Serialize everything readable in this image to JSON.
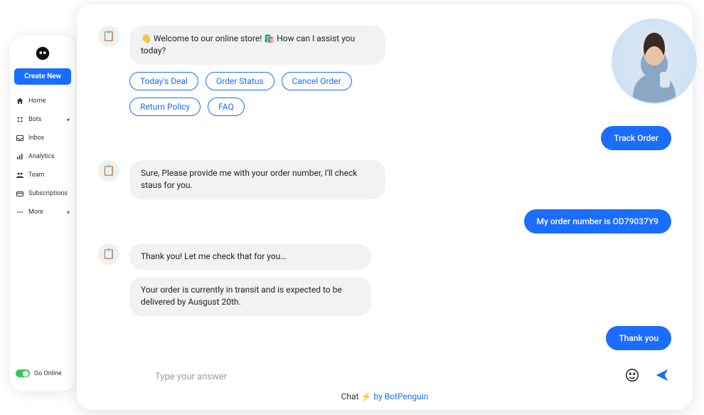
{
  "sidebar": {
    "create_label": "Create New",
    "items": [
      {
        "label": "Home"
      },
      {
        "label": "Bots"
      },
      {
        "label": "Inbox"
      },
      {
        "label": "Analytics"
      },
      {
        "label": "Team"
      },
      {
        "label": "Subscriptions"
      },
      {
        "label": "More"
      }
    ],
    "online_label": "Go Online"
  },
  "chat": {
    "bot_icon": "📋",
    "messages": {
      "welcome": "👋 Welcome to our online store! 🛍️ How can I assist you today?",
      "provide_order": "Sure, Please provide me with your order number, I'll check staus for you.",
      "checking": "Thank you! Let me check that for you…",
      "status": "Your order is currently in transit and is expected to be delivered by Ausgust 20th."
    },
    "user_messages": {
      "track": "Track Order",
      "order_no": "My order number is  OD79037Y9",
      "thanks": "Thank you"
    },
    "chips": [
      "Today's Deal",
      "Order Status",
      "Cancel Order",
      "Return Policy",
      "FAQ"
    ],
    "input_placeholder": "Type your answer",
    "footer_prefix": "Chat ",
    "footer_emoji": "⚡",
    "footer_suffix": "by BotPenguin"
  }
}
